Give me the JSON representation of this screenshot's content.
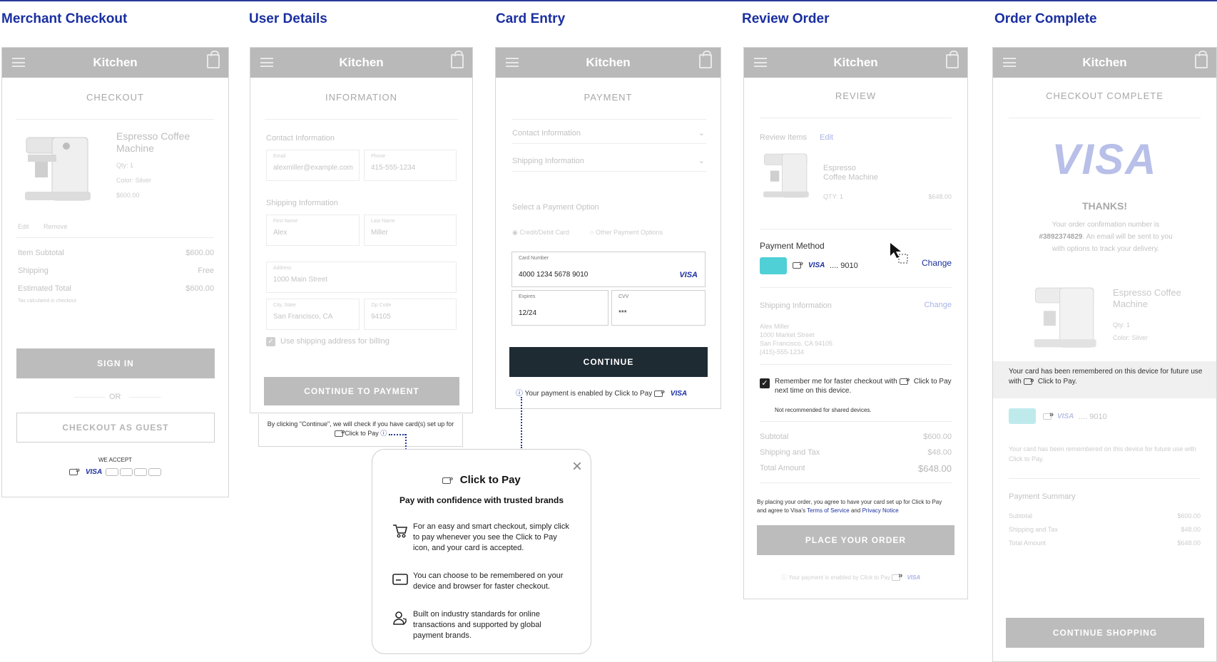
{
  "titles": [
    "Merchant Checkout",
    "User Details",
    "Card Entry",
    "Review Order",
    "Order Complete"
  ],
  "brand": "Kitchen",
  "icons": {
    "menu": "menu-icon",
    "bag": "shopping-bag-icon",
    "close": "close-icon",
    "cart": "cart-icon",
    "card": "card-icon",
    "user": "user-shield-icon",
    "info": "info-icon",
    "cursor": "cursor-arrow-icon",
    "chevron": "chevron-down-icon"
  },
  "colors": {
    "accent": "#1a2fa0",
    "dark_button": "#1f2b33",
    "header_grey": "#b9b9b9"
  },
  "checkout": {
    "section": "CHECKOUT",
    "product_name": "Espresso Coffee Machine",
    "qty": "Qty: 1",
    "color": "Color: Silver",
    "price": "$600.00",
    "edit": "Edit",
    "remove": "Remove",
    "item_subtotal_label": "Item Subtotal",
    "item_subtotal": "$600.00",
    "shipping_label": "Shipping",
    "shipping": "Free",
    "estimated_total_label": "Estimated Total",
    "estimated_total": "$600.00",
    "tax_note": "Tax calculated in checkout",
    "sign_in": "SIGN IN",
    "or": "OR",
    "guest": "CHECKOUT AS GUEST",
    "we_accept": "WE ACCEPT",
    "visa": "VISA"
  },
  "information": {
    "section": "INFORMATION",
    "contact_label": "Contact Information",
    "email_label": "Email",
    "email": "alexmiller@example.com",
    "phone_label": "Phone",
    "phone": "415-555-1234",
    "shipping_label": "Shipping Information",
    "first_name_label": "First Name",
    "first_name": "Alex",
    "last_name_label": "Last Name",
    "last_name": "Miller",
    "address_label": "Address",
    "address": "1000 Main Street",
    "city_label": "City, State",
    "city": "San Francisco, CA",
    "zip_label": "Zip Code",
    "zip": "94105",
    "use_shipping": "Use shipping address for billing",
    "continue": "CONTINUE TO PAYMENT",
    "note": "By clicking \"Continue\", we will check if you have card(s) set up for",
    "note_ctp": "Click to Pay"
  },
  "payment": {
    "section": "PAYMENT",
    "contact": "Contact Information",
    "shipping": "Shipping Information",
    "select_option": "Select a Payment Option",
    "opt_card": "Credit/Debit Card",
    "opt_other": "Other Payment Options",
    "card_number_label": "Card Number",
    "card_number": "4000 1234 5678 9010",
    "expires_label": "Expires",
    "expires": "12/24",
    "cvv_label": "CVV",
    "cvv": "***",
    "continue": "CONTINUE",
    "enabled_text": "Your payment is enabled by Click to Pay",
    "visa": "VISA"
  },
  "modal": {
    "title": "Click to Pay",
    "subtitle": "Pay with confidence with trusted brands",
    "item1": "For an easy and smart checkout, simply click to pay whenever you see the Click to Pay icon, and your card is accepted.",
    "item2": "You can choose to be remembered on your device and browser for faster checkout.",
    "item3": "Built on industry standards for online transactions and supported by global payment brands."
  },
  "review": {
    "section": "REVIEW",
    "review_items": "Review Items",
    "edit": "Edit",
    "product_line1": "Espresso",
    "product_line2": "Coffee Machine",
    "qty": "QTY: 1",
    "price": "$648.00",
    "payment_method": "Payment Method",
    "visa": "VISA",
    "last4": ".... 9010",
    "change": "Change",
    "shipping_info": "Shipping Information",
    "shipping_change": "Change",
    "addr1": "Alex Miller",
    "addr2": "1000 Market Street",
    "addr3": "San Francisco, CA 94105",
    "addr4": "(415)-555-1234",
    "remember": "Remember me for faster checkout with",
    "remember_ctp": "Click to Pay next time on this device.",
    "not_recommended": "Not recommended for shared devices.",
    "subtotal_label": "Subtotal",
    "subtotal": "$600.00",
    "ship_tax_label": "Shipping and Tax",
    "ship_tax": "$48.00",
    "total_label": "Total Amount",
    "total": "$648.00",
    "agree1": "By placing your order, you agree to have your card set up for Click to Pay",
    "agree2": "and agree to Visa's",
    "terms": "Terms of Service",
    "and": "and",
    "privacy": "Privacy Notice",
    "place_order": "PLACE YOUR ORDER",
    "enabled_text": "Your payment is enabled by Click to Pay",
    "enabled_visa": "VISA"
  },
  "complete": {
    "section": "CHECKOUT COMPLETE",
    "logo": "VISA",
    "thanks": "THANKS!",
    "conf1": "Your order confirmation number is",
    "conf_number": "#3892374829",
    "conf2": ". An email will be sent to you",
    "conf3": "with options to track your delivery.",
    "product_name": "Espresso Coffee Machine",
    "qty": "Qty: 1",
    "color": "Color: Silver",
    "remembered": "Your card has been remembered on this device for future use with",
    "remembered_ctp": "Click to Pay.",
    "visa": "VISA",
    "last4": ".... 9010",
    "remembered_faint": "Your card has been remembered on this device for future use with",
    "remembered_faint_ctp": "Click to Pay.",
    "summary": "Payment Summary",
    "subtotal_label": "Subtotal",
    "subtotal": "$600.00",
    "ship_tax_label": "Shipping and Tax",
    "ship_tax": "$48.00",
    "total_label": "Total Amount",
    "total": "$648.00",
    "continue": "CONTINUE SHOPPING"
  }
}
